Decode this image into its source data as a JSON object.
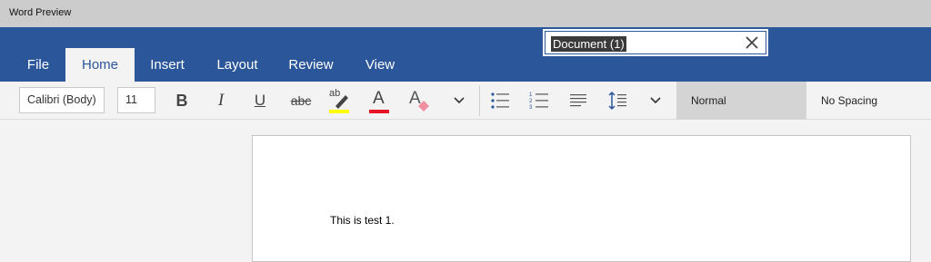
{
  "window": {
    "title": "Word Preview"
  },
  "tabs": [
    {
      "label": "File"
    },
    {
      "label": "Home"
    },
    {
      "label": "Insert"
    },
    {
      "label": "Layout"
    },
    {
      "label": "Review"
    },
    {
      "label": "View"
    }
  ],
  "active_tab": "Home",
  "document": {
    "title": "Document (1)"
  },
  "toolbar": {
    "font_name": "Calibri (Body)",
    "font_size": "11",
    "bold": "B",
    "italic": "I",
    "underline": "U",
    "strikethrough": "abc",
    "highlight": "ab",
    "font_color_letter": "A",
    "clear_format_letter": "A",
    "styles": [
      "Normal",
      "No Spacing"
    ]
  },
  "colors": {
    "ribbon": "#2b579a",
    "highlight": "#ffff00",
    "font_color": "#e81123"
  },
  "page": {
    "text": "This is test 1."
  }
}
